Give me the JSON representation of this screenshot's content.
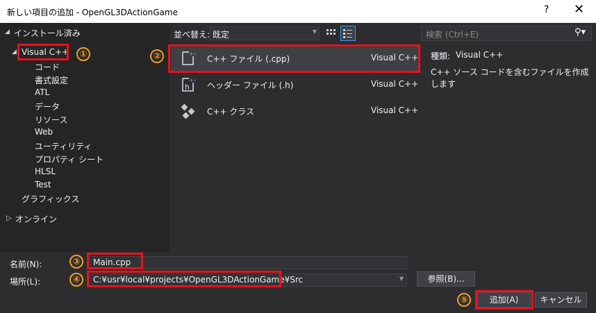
{
  "window": {
    "title": "新しい項目の追加 - OpenGL3DActionGame",
    "help": "?",
    "close": "✕"
  },
  "tree": {
    "installed": "インストール済み",
    "root": "Visual C++",
    "children": [
      "コード",
      "書式設定",
      "ATL",
      "データ",
      "リソース",
      "Web",
      "ユーティリティ",
      "プロパティ シート",
      "HLSL",
      "Test"
    ],
    "graphics": "グラフィックス",
    "online": "オンライン"
  },
  "sort": {
    "label": "並べ替え:",
    "value": "既定"
  },
  "search": {
    "placeholder": "検索 (Ctrl+E)"
  },
  "templates": [
    {
      "name": "C++ ファイル (.cpp)",
      "lang": "Visual C++"
    },
    {
      "name": "ヘッダー ファイル (.h)",
      "lang": "Visual C++"
    },
    {
      "name": "C++ クラス",
      "lang": "Visual C++"
    }
  ],
  "details": {
    "type_label": "種類:",
    "type_value": "Visual C++",
    "description": "C++ ソース コードを含むファイルを作成します"
  },
  "form": {
    "name_label": "名前(N):",
    "name_value": "Main.cpp",
    "location_label": "場所(L):",
    "location_value": "C:¥usr¥local¥projects¥OpenGL3DActionGame¥Src",
    "browse_label": "参照(B)...",
    "add_label": "追加(A)",
    "cancel_label": "キャンセル"
  },
  "annotations": [
    "①",
    "②",
    "③",
    "④",
    "⑤"
  ],
  "colors": {
    "highlight": "#e8111c",
    "callout": "#f0a020",
    "accent": "#3399ff",
    "icon_purple": "#b180d7"
  }
}
